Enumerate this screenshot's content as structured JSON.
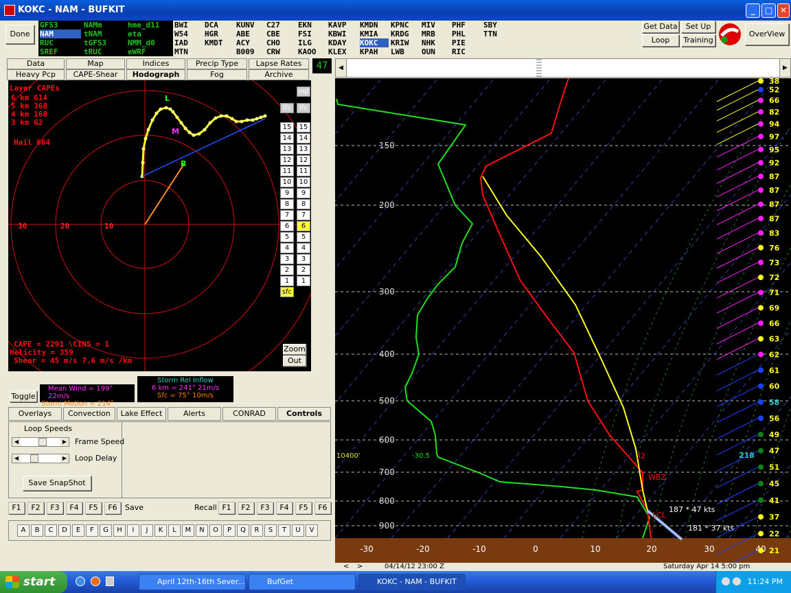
{
  "window": {
    "title": "KOKC - NAM - BUFKIT"
  },
  "toolbar": {
    "done": "Done",
    "get_data": "Get Data",
    "set_up": "Set Up",
    "loop": "Loop",
    "training": "Training",
    "overview": "OverView",
    "frame_number": "47"
  },
  "models": [
    {
      "label": "GFS3",
      "col": 0,
      "row": 0,
      "selected": false
    },
    {
      "label": "NAMm",
      "col": 1,
      "row": 0,
      "selected": false
    },
    {
      "label": "hme_d11",
      "col": 2,
      "row": 0,
      "selected": false
    },
    {
      "label": "NAM",
      "col": 0,
      "row": 1,
      "selected": true
    },
    {
      "label": "tNAM",
      "col": 1,
      "row": 1,
      "selected": false
    },
    {
      "label": "eta",
      "col": 2,
      "row": 1,
      "selected": false
    },
    {
      "label": "RUC",
      "col": 0,
      "row": 2,
      "selected": false
    },
    {
      "label": "tGFS3",
      "col": 1,
      "row": 2,
      "selected": false
    },
    {
      "label": "NMM_d0",
      "col": 2,
      "row": 2,
      "selected": false
    },
    {
      "label": "SREF",
      "col": 0,
      "row": 3,
      "selected": false
    },
    {
      "label": "tRUC",
      "col": 1,
      "row": 3,
      "selected": false
    },
    {
      "label": "eWRF",
      "col": 2,
      "row": 3,
      "selected": false
    }
  ],
  "stations": [
    [
      "BWI",
      "W54",
      "IAD",
      "MTN"
    ],
    [
      "DCA",
      "HGR",
      "KMDT",
      ""
    ],
    [
      "KUNV",
      "ABE",
      "ACY",
      "B009"
    ],
    [
      "C27",
      "CBE",
      "CHO",
      "CRW"
    ],
    [
      "EKN",
      "FSI",
      "ILG",
      "KAOO"
    ],
    [
      "KAVP",
      "KBWI",
      "KDAY",
      "KLEX"
    ],
    [
      "KMDN",
      "KMIA",
      "KOKC",
      "KPAH"
    ],
    [
      "KPNC",
      "KRDG",
      "KRIW",
      "LWB"
    ],
    [
      "MIV",
      "MRB",
      "NHK",
      "OUN"
    ],
    [
      "PHF",
      "PHL",
      "PIE",
      "RIC"
    ],
    [
      "SBY",
      "TTN",
      "",
      ""
    ]
  ],
  "selected_station": "KOKC",
  "tabs_row1": [
    "Data",
    "Map",
    "Indices",
    "Precip Type",
    "Lapse Rates"
  ],
  "tabs_row2": [
    "Heavy Pcp",
    "CAPE-Shear",
    "Hodograph",
    "Fog",
    "Archive"
  ],
  "active_tab": "Hodograph",
  "hodograph": {
    "layer_capes_title": "Layer CAPEs",
    "layer_capes": [
      "6 km  614",
      "5 km  368",
      "4 km  168",
      "3 km  62"
    ],
    "hail": "Hail  664",
    "eql_button": "eql",
    "lfc_buttons": [
      "lfc",
      "lfc"
    ],
    "range_labels": [
      "30",
      "20",
      "10"
    ],
    "level_buttons_left": [
      "15",
      "14",
      "13",
      "12",
      "11",
      "10",
      "9",
      "8",
      "7",
      "6",
      "5",
      "4",
      "3",
      "2",
      "1",
      "sfc"
    ],
    "level_buttons_right": [
      "15",
      "14",
      "13",
      "12",
      "11",
      "10",
      "9",
      "8",
      "7",
      "6",
      "5",
      "4",
      "3",
      "2",
      "1"
    ],
    "highlighted_level": "6",
    "point_labels": {
      "left": "L",
      "mean": "M",
      "right": "R"
    },
    "cape_line": "CAPE =  2291  \\CINS =  1",
    "helicity_line": "Helicity =  359",
    "shear_line": "Shear =  45 m/s   7.6 m/s /km",
    "zoom": "Zoom",
    "out": "Out"
  },
  "wind_info": {
    "toggle": "Toggle",
    "mean_wind": "Mean Wind = 199°  22m/s",
    "storm_motion": "Storm Motion = 214°",
    "storm_rel_title": "Storm Rel Inflow",
    "six_km": "6 km = 241°  21m/s",
    "sfc": "Sfc = 75°  10m/s"
  },
  "lower_tabs": [
    "Overlays",
    "Convection",
    "Lake Effect",
    "Alerts",
    "CONRAD",
    "Controls"
  ],
  "active_lower_tab": "Controls",
  "controls": {
    "loop_speeds": "Loop Speeds",
    "frame_speed": "Frame Speed",
    "loop_delay": "Loop Delay",
    "save_snapshot": "Save SnapShot"
  },
  "fkeys_save": [
    "F1",
    "F2",
    "F3",
    "F4",
    "F5",
    "F6"
  ],
  "save_label": "Save",
  "recall_label": "Recall",
  "fkeys_recall": [
    "F1",
    "F2",
    "F3",
    "F4",
    "F5",
    "F6"
  ],
  "letters": [
    "A",
    "B",
    "C",
    "D",
    "E",
    "F",
    "G",
    "H",
    "I",
    "J",
    "K",
    "L",
    "M",
    "N",
    "O",
    "P",
    "Q",
    "R",
    "S",
    "T",
    "U",
    "V"
  ],
  "skewt": {
    "pressure_labels": [
      "150",
      "200",
      "300",
      "400",
      "500",
      "600",
      "700",
      "800",
      "900"
    ],
    "temp_labels": [
      "-30",
      "-20",
      "-10",
      "0",
      "10",
      "20",
      "30",
      "40"
    ],
    "wind_speeds": [
      "38",
      "52",
      "66",
      "82",
      "94",
      "97",
      "95",
      "92",
      "87",
      "87",
      "87",
      "87",
      "83",
      "76",
      "73",
      "72",
      "71",
      "69",
      "66",
      "63",
      "62",
      "61",
      "60",
      "58",
      "56",
      "49",
      "47",
      "51",
      "45",
      "41",
      "37",
      "22",
      "21"
    ],
    "storm_speed": "218",
    "height_label": "10400'",
    "temp_at_height": "-30.5",
    "level_label_32": "32",
    "wbz_label": "WBZ",
    "lcl_label": "LCL",
    "wind1": "187 * 47 kts",
    "wind2": "181 * 37 kts"
  },
  "timeline": {
    "date": "04/14/12   23:00 Z",
    "local": "Saturday   Apr 14  5:00 pm"
  },
  "taskbar": {
    "start": "start",
    "tasks": [
      "April 12th-16th Sever...",
      "BufGet",
      "KOKC - NAM - BUFKIT"
    ],
    "clock": "11:24 PM"
  }
}
